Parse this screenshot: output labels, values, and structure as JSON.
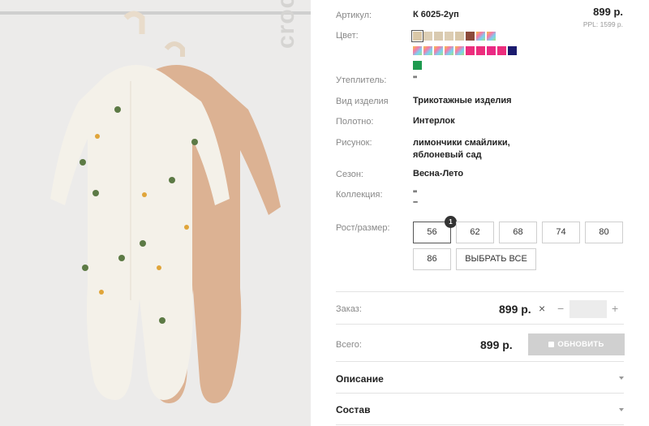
{
  "photo": {
    "brand": "crockid"
  },
  "product": {
    "article_label": "Артикул:",
    "article_value": "К 6025-2уп",
    "price": "899 р.",
    "ppl": "PPL: 1599 р.",
    "color_label": "Цвет:",
    "colors": [
      {
        "color": "#d9c7a7",
        "kind": "solid",
        "selected": true
      },
      {
        "color": "#ddcfb5",
        "kind": "solid"
      },
      {
        "color": "#d9cab0",
        "kind": "solid"
      },
      {
        "color": "#dccdb3",
        "kind": "solid"
      },
      {
        "color": "#d8c7a9",
        "kind": "solid"
      },
      {
        "color": "#8b4a3a",
        "kind": "solid"
      },
      {
        "color": "multicolor",
        "kind": "multi"
      },
      {
        "color": "multicolor",
        "kind": "multi"
      },
      {
        "color": "multicolor",
        "kind": "multi"
      },
      {
        "color": "multicolor",
        "kind": "multi"
      },
      {
        "color": "multicolor",
        "kind": "multi"
      },
      {
        "color": "multicolor",
        "kind": "multi"
      },
      {
        "color": "multicolor",
        "kind": "multi"
      },
      {
        "color": "#ec2e7d",
        "kind": "solid"
      },
      {
        "color": "#ec2e7d",
        "kind": "solid"
      },
      {
        "color": "#ea2a84",
        "kind": "solid"
      },
      {
        "color": "#ec2e7d",
        "kind": "solid"
      },
      {
        "color": "#1b1b6e",
        "kind": "solid"
      },
      {
        "color": "#1e9a4f",
        "kind": "solid"
      }
    ],
    "insulation_label": "Утеплитель:",
    "insulation_value": "\"",
    "type_label": "Вид изделия",
    "type_value": "Трикотажные изделия",
    "fabric_label": "Полотно:",
    "fabric_value": "Интерлок",
    "pattern_label": "Рисунок:",
    "pattern_value_1": "лимончики смайлики,",
    "pattern_value_2": "яблоневый сад",
    "season_label": "Сезон:",
    "season_value": "Весна-Лето",
    "collection_label": "Коллекция:",
    "collection_value_1": "\"",
    "collection_value_2": "–",
    "size_label": "Рост/размер:",
    "sizes": [
      "56",
      "62",
      "68",
      "74",
      "80",
      "86"
    ],
    "select_all": "ВЫБРАТЬ ВСЕ",
    "size_qty_badge": "1"
  },
  "order": {
    "order_label": "Заказ:",
    "order_price": "899 р.",
    "multiply": "×",
    "minus": "−",
    "plus": "+",
    "qty_value": "",
    "total_label": "Всего:",
    "total_price": "899 р.",
    "update_button": "ОБНОВИТЬ"
  },
  "accordion": {
    "description": "Описание",
    "composition": "Состав"
  }
}
